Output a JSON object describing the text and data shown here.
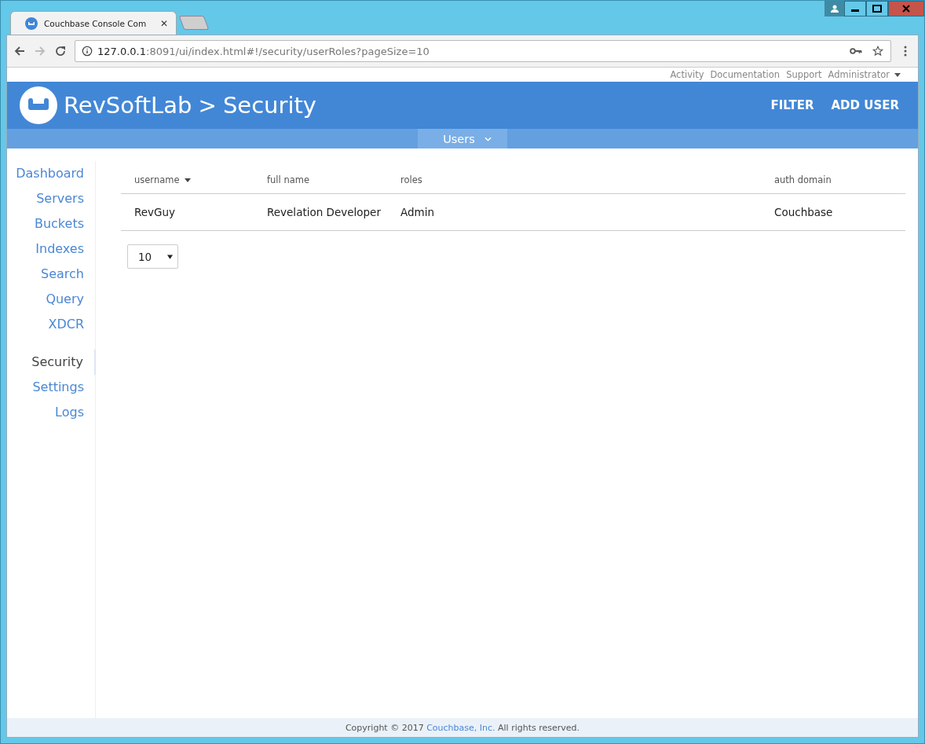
{
  "browser": {
    "tabs": [
      {
        "title": "Couchbase Console Com",
        "close": "✕",
        "selected": true
      },
      {
        "selected": false
      }
    ],
    "address": {
      "host": "127.0.0.1",
      "path": ":8091/ui/index.html#!/security/userRoles?pageSize=10"
    }
  },
  "top_links": [
    "Activity",
    "Documentation",
    "Support",
    "Administrator"
  ],
  "header": {
    "cluster": "RevSoftLab",
    "separator": ">",
    "section": "Security",
    "actions": [
      "FILTER",
      "ADD USER"
    ]
  },
  "subnav": {
    "label": "Users",
    "selected": true
  },
  "sidebar": {
    "groups": [
      [
        {
          "label": "Dashboard",
          "selected": false
        },
        {
          "label": "Servers",
          "selected": false
        },
        {
          "label": "Buckets",
          "selected": false
        },
        {
          "label": "Indexes",
          "selected": false
        },
        {
          "label": "Search",
          "selected": false
        },
        {
          "label": "Query",
          "selected": false
        },
        {
          "label": "XDCR",
          "selected": false
        }
      ],
      [
        {
          "label": "Security",
          "selected": true
        },
        {
          "label": "Settings",
          "selected": false
        },
        {
          "label": "Logs",
          "selected": false
        }
      ]
    ]
  },
  "table": {
    "columns": [
      {
        "label": "username",
        "sorted": true
      },
      {
        "label": "full name",
        "sorted": false
      },
      {
        "label": "roles",
        "sorted": false
      },
      {
        "label": "auth domain",
        "sorted": false
      }
    ],
    "rows": [
      [
        "RevGuy",
        "Revelation Developer",
        "Admin",
        "Couchbase"
      ]
    ]
  },
  "page_size": {
    "value": "10"
  },
  "footer": {
    "before": "Copyright © 2017 ",
    "link": "Couchbase, Inc.",
    "after": " All rights reserved."
  }
}
